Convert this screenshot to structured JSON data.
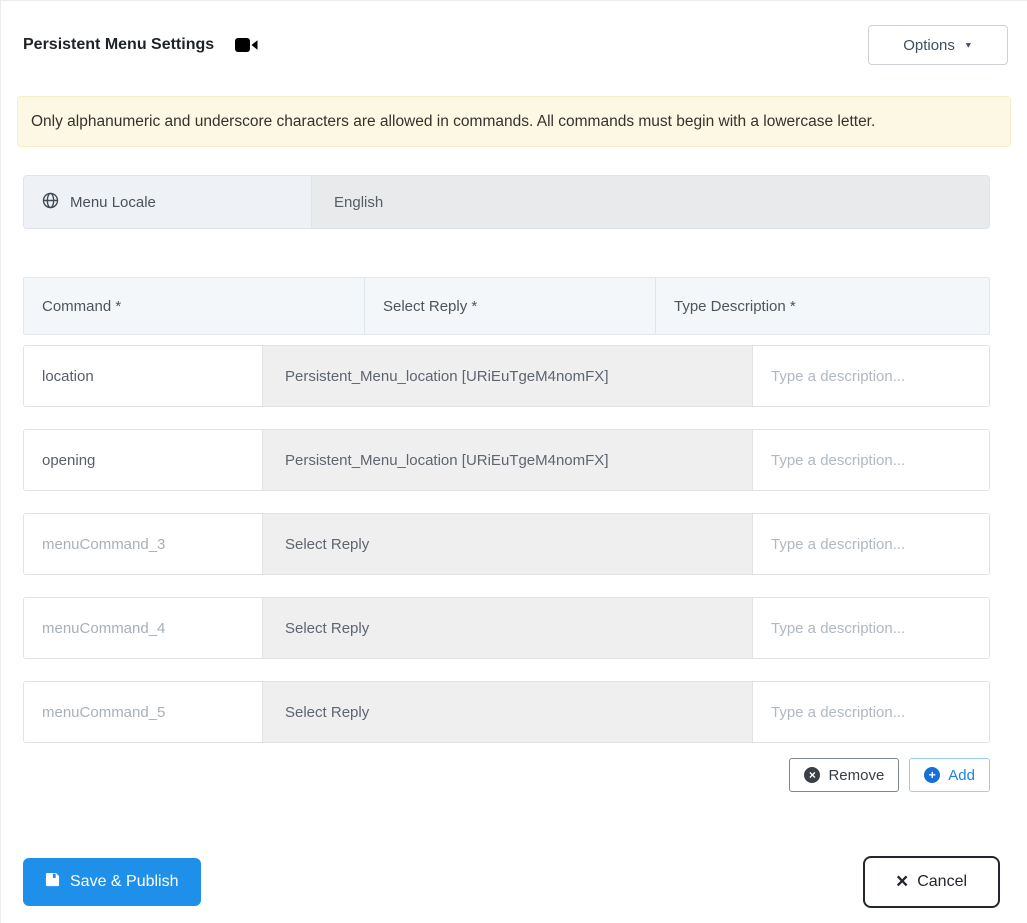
{
  "colors": {
    "primary": "#1e90ea",
    "add-blue": "#1770d6",
    "remove-dark": "#3b4046",
    "alert-bg": "#fcf8e3",
    "alert-border": "#f5eecb",
    "reply-bg": "#efefef",
    "header-bg": "#f4f7fa",
    "locale-label-bg": "#eef1f6",
    "locale-value-bg": "#e9eaeb"
  },
  "header": {
    "title": "Persistent Menu Settings",
    "options_button": "Options"
  },
  "icons": {
    "caret_down": "▼",
    "remove_x": "×",
    "add_plus": "+",
    "cancel_x": "×"
  },
  "alert": {
    "text": "Only alphanumeric and underscore characters are allowed in commands. All commands must begin with a lowercase letter."
  },
  "locale": {
    "label": "Menu Locale",
    "value": "English"
  },
  "table": {
    "headers": [
      "Command *",
      "Select Reply *",
      "Type Description *"
    ],
    "rows": [
      {
        "command": "location",
        "command_placeholder": "",
        "reply": "Persistent_Menu_location [URiEuTgeM4nomFX]",
        "description": "",
        "description_placeholder": "Type a description..."
      },
      {
        "command": "opening",
        "command_placeholder": "",
        "reply": "Persistent_Menu_location [URiEuTgeM4nomFX]",
        "description": "",
        "description_placeholder": "Type a description..."
      },
      {
        "command": "",
        "command_placeholder": "menuCommand_3",
        "reply": "Select Reply",
        "description": "",
        "description_placeholder": "Type a description..."
      },
      {
        "command": "",
        "command_placeholder": "menuCommand_4",
        "reply": "Select Reply",
        "description": "",
        "description_placeholder": "Type a description..."
      },
      {
        "command": "",
        "command_placeholder": "menuCommand_5",
        "reply": "Select Reply",
        "description": "",
        "description_placeholder": "Type a description..."
      }
    ]
  },
  "actions": {
    "remove_label": "Remove",
    "add_label": "Add"
  },
  "footer": {
    "save_label": "Save & Publish",
    "cancel_label": "Cancel"
  }
}
